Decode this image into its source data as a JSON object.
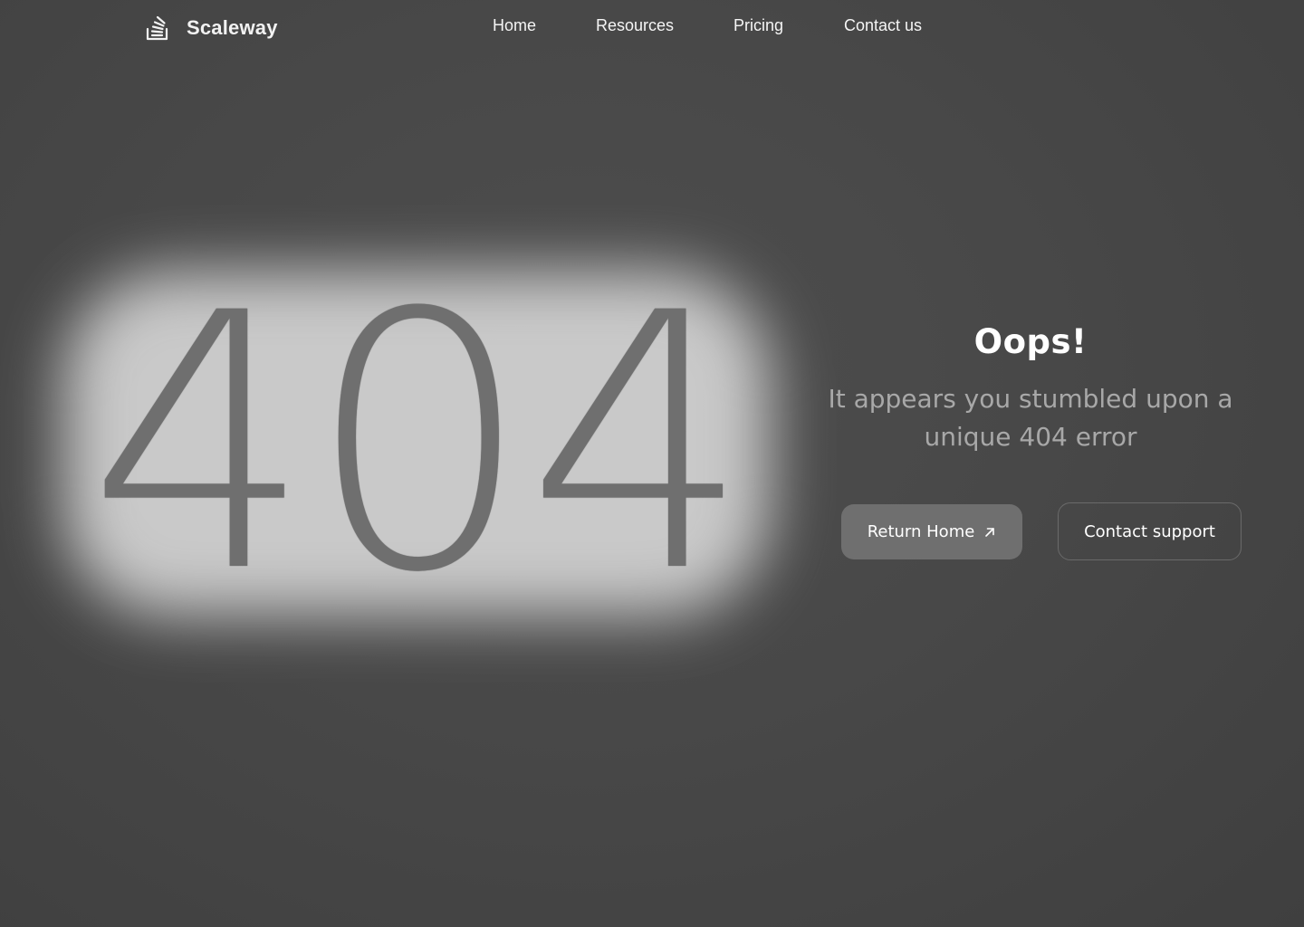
{
  "header": {
    "brand": "Scaleway",
    "logo_icon": "stacked-layers-icon",
    "nav": [
      {
        "label": "Home"
      },
      {
        "label": "Resources"
      },
      {
        "label": "Pricing"
      },
      {
        "label": "Contact us"
      }
    ]
  },
  "hero": {
    "code": "404",
    "title": "Oops!",
    "subtitle": "It appears you stumbled upon a unique 404 error"
  },
  "actions": {
    "return_home": "Return Home",
    "return_home_icon": "arrow-up-right-icon",
    "contact_support": "Contact support"
  },
  "colors": {
    "background": "#484848",
    "code_text": "#6f6f6f",
    "glow": "#d0d0d0",
    "primary_button": "#6f6f6f",
    "subtitle_text": "#a8a8a8",
    "outline_border": "#6a6a6a"
  }
}
